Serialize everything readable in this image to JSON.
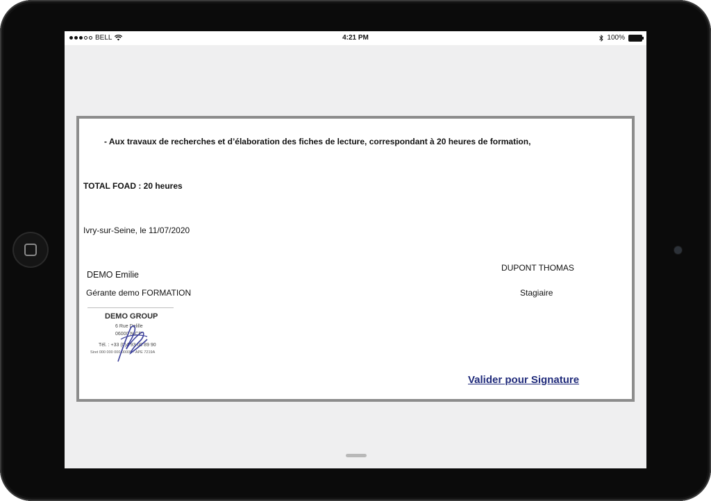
{
  "statusbar": {
    "carrier": "BELL",
    "time": "4:21 PM",
    "battery": "100%",
    "signal_bars_filled": 3,
    "signal_bars_total": 5
  },
  "document": {
    "line1": "- Aux travaux de recherches et d’élaboration des fiches de lecture, correspondant à 20 heures de formation,",
    "total": "TOTAL FOAD : 20 heures",
    "place_date": "Ivry-sur-Seine, le 11/07/2020",
    "signer_name": "DEMO Emilie",
    "signer_title": "Gérante demo FORMATION",
    "trainee_name": "DUPONT THOMAS",
    "trainee_role": "Stagiaire",
    "stamp": {
      "company": "DEMO GROUP",
      "address": "6 Rue Delille",
      "city": "06000 NICE",
      "phone": "Tél. : +33 (0)4 93 00 89 90",
      "registration": "Siret 000 000 000 00000 - APE 7219A"
    },
    "validate_link": "Valider pour Signature"
  },
  "colors": {
    "link": "#1f2a7a",
    "frame": "#8c8c8c",
    "screen_bg": "#efeff0",
    "stamp_ink": "#3b3f9a"
  }
}
